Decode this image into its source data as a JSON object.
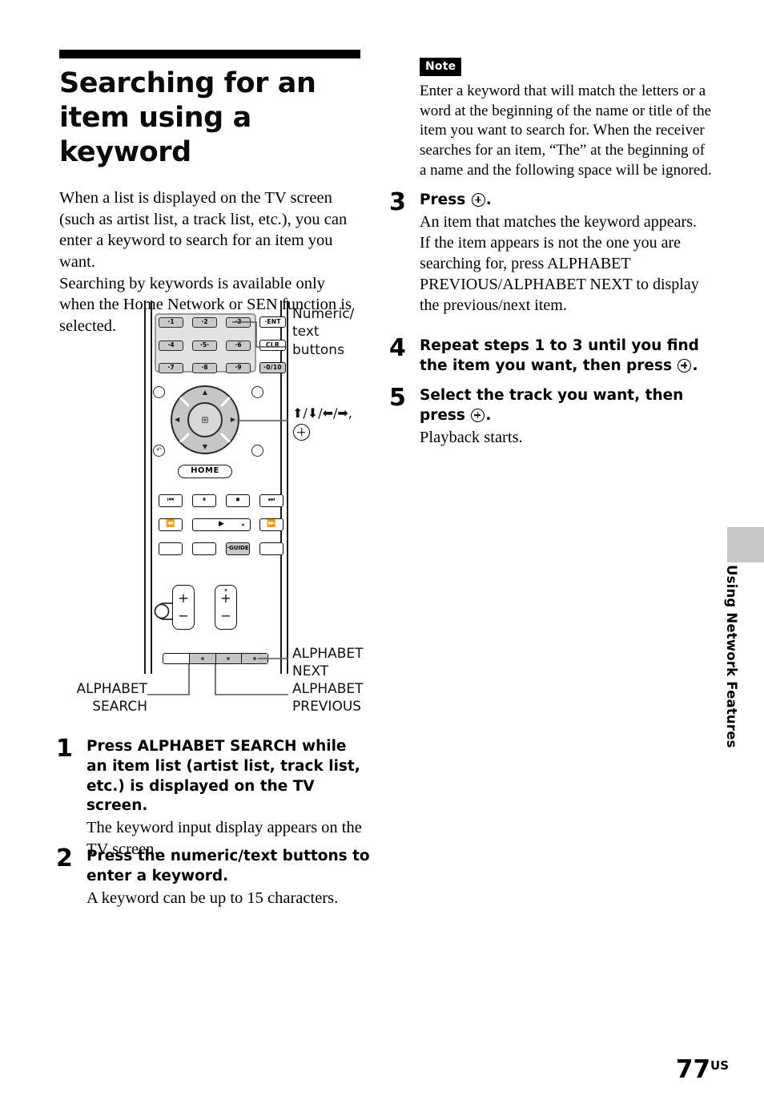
{
  "document": {
    "page_number": "77",
    "page_number_suffix": "US",
    "side_tab_text": "Using Network Features"
  },
  "left_column": {
    "title": "Searching for an item using a keyword",
    "intro": "When a list is displayed on the TV screen (such as artist list, a track list, etc.), you can enter a keyword to search for an item you want.\nSearching by keywords is available only when the Home Network or SEN function is selected."
  },
  "remote": {
    "callouts": {
      "numeric_text_buttons": "Numeric/\ntext\nbuttons",
      "dpad_label": "⬆/⬇/⬅/➡,",
      "alphabet_next": "ALPHABET\nNEXT",
      "alphabet_previous": "ALPHABET\nPREVIOUS",
      "alphabet_search": "ALPHABET\nSEARCH"
    },
    "numeric_buttons": [
      "1",
      "2",
      "3",
      "4",
      "5",
      "6",
      "7",
      "8",
      "9"
    ],
    "side_buttons": {
      "ent": "ENT",
      "clr": "CLR",
      "zero_ten": "0/10"
    },
    "home_button": "HOME",
    "transport_buttons": {
      "prev": "⏮",
      "pause": "⏸",
      "stop": "⏹",
      "next": "⏭",
      "rewind": "⏪",
      "play": "▶",
      "forward": "⏩",
      "guide": "GUIDE"
    },
    "rocker_symbols": {
      "plus": "+",
      "minus": "−"
    }
  },
  "note": {
    "badge": "Note",
    "text": "Enter a keyword that will match the letters or a word at the beginning of the name or title of the item you want to search for. When the receiver searches for an item, “The” at the beginning of a name and the following space will be ignored."
  },
  "steps": [
    {
      "number": "1",
      "heading": "Press ALPHABET SEARCH while an item list (artist list, track list, etc.) is displayed on the TV screen.",
      "sub": "The keyword input display appears on the TV screen."
    },
    {
      "number": "2",
      "heading": "Press the numeric/text buttons to enter a keyword.",
      "sub": "A keyword can be up to 15 characters."
    },
    {
      "number": "3",
      "heading_prefix": "Press",
      "heading_suffix": ".",
      "sub": "An item that matches the keyword appears. If the item appears is not the one you are searching for, press ALPHABET PREVIOUS/ALPHABET NEXT to display the previous/next item."
    },
    {
      "number": "4",
      "heading_prefix": "Repeat steps 1 to 3 until you find the item you want, then press",
      "heading_suffix": ".",
      "sub": ""
    },
    {
      "number": "5",
      "heading_prefix": "Select the track you want, then press",
      "heading_suffix": ".",
      "sub": "Playback starts."
    }
  ],
  "colors": {
    "rule": "#000000",
    "note_badge_bg": "#000000",
    "side_tab": "#c8c8c8",
    "button_gray": "#c9c9c9"
  }
}
